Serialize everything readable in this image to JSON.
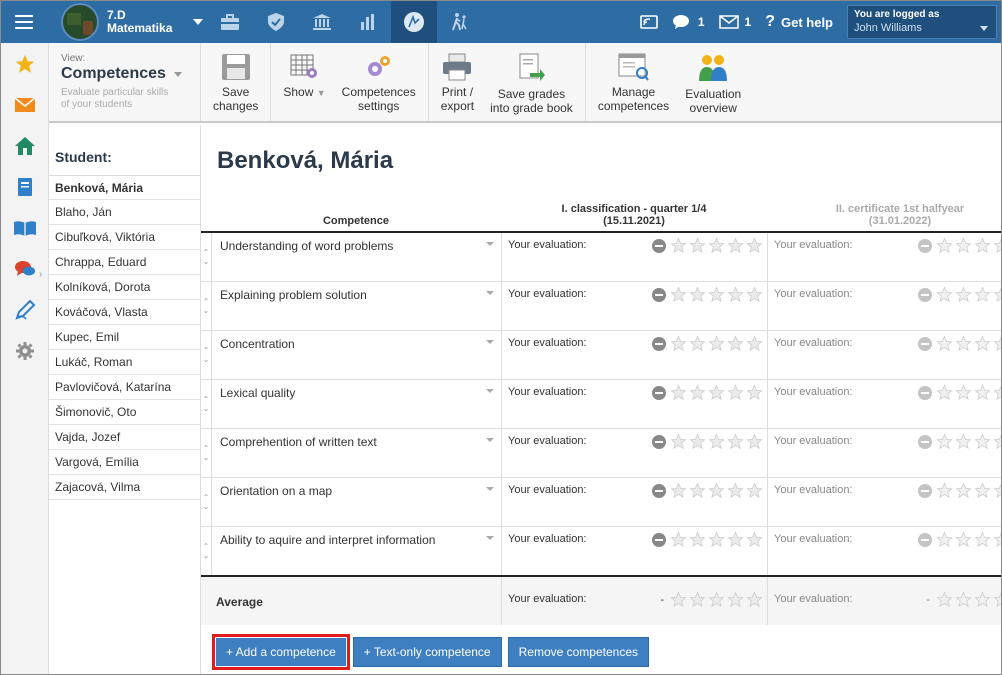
{
  "topbar": {
    "class_name": "7.D",
    "subject": "Matematika",
    "messages_count": "1",
    "mail_count": "1",
    "help_label": "Get help",
    "login_label": "You are logged as",
    "user_name": "John Williams",
    "nav_icons": [
      "briefcase-icon",
      "shield-icon",
      "bank-icon",
      "bar-chart-icon",
      "compass-icon",
      "walking-icon"
    ],
    "accent": "#2e6da4"
  },
  "sidebar_icons": [
    "star-icon",
    "mail-icon",
    "home-icon",
    "book-icon",
    "open-book-icon",
    "chat-icon",
    "pencil-icon",
    "gear-icon"
  ],
  "toolbar": {
    "view_label": "View:",
    "view_name": "Competences",
    "view_desc": "Evaluate particular skills of your students",
    "save": "Save\nchanges",
    "show": "Show",
    "settings": "Competences\nsettings",
    "print": "Print /\nexport",
    "save_grades": "Save grades\ninto grade book",
    "manage": "Manage\ncompetences",
    "overview": "Evaluation\noverview"
  },
  "students": {
    "header": "Student:",
    "selected": "Benková, Mária",
    "list": [
      "Benková, Mária",
      "Blaho, Ján",
      "Cibuľková, Viktória",
      "Chrappa, Eduard",
      "Kolníková, Dorota",
      "Kováčová, Vlasta",
      "Kupec, Emil",
      "Lukáč, Roman",
      "Pavlovičová, Katarína",
      "Šimonovič, Oto",
      "Vajda, Jozef",
      "Vargová, Emília",
      "Zajacová, Vilma"
    ]
  },
  "main": {
    "pupil_name": "Benková, Mária",
    "col_competence": "Competence",
    "col_period1": "I. classification - quarter 1/4",
    "col_period1_date": "(15.11.2021)",
    "col_period2": "II. certificate 1st halfyear",
    "col_period2_date": "(31.01.2022)",
    "eval_label": "Your evaluation:",
    "competences": [
      "Understanding of word problems",
      "Explaining problem solution",
      "Concentration",
      "Lexical quality",
      "Comprehention of written text",
      "Orientation on a map",
      "Ability to aquire and interpret information"
    ],
    "average_label": "Average",
    "average_value": "-",
    "buttons": {
      "add": "+ Add a competence",
      "text_only": "+ Text-only competence",
      "remove": "Remove competences"
    }
  }
}
